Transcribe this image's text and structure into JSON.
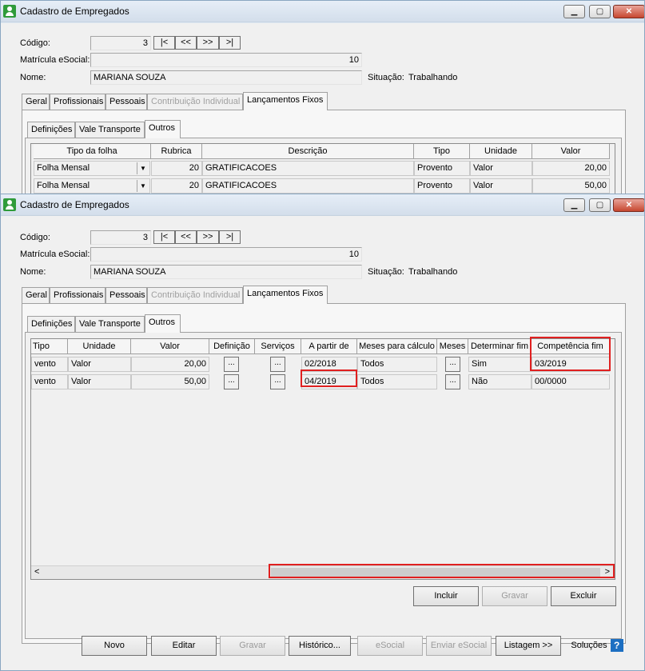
{
  "windows": [
    {
      "title": "Cadastro de Empregados",
      "controls": {
        "minimize": "▁",
        "maximize": "▢",
        "close": "✕"
      },
      "form": {
        "codigo_label": "Código:",
        "codigo_value": "3",
        "nav": [
          "|<",
          "<<",
          ">>",
          ">|"
        ],
        "matricula_label": "Matrícula eSocial:",
        "matricula_value": "10",
        "nome_label": "Nome:",
        "nome_value": "MARIANA SOUZA",
        "situacao_label": "Situação:",
        "situacao_value": "Trabalhando"
      },
      "tabs": [
        "Geral",
        "Profissionais",
        "Pessoais",
        "Contribuição Individual",
        "Lançamentos Fixos"
      ],
      "subtabs": [
        "Definições",
        "Vale Transporte",
        "Outros"
      ],
      "grid_headers": [
        "Tipo da folha",
        "Rubrica",
        "Descrição",
        "Tipo",
        "Unidade",
        "Valor"
      ],
      "rows": [
        {
          "tipo_folha": "Folha Mensal",
          "rubrica": "20",
          "descricao": "GRATIFICACOES",
          "tipo": "Provento",
          "unidade": "Valor",
          "valor": "20,00"
        },
        {
          "tipo_folha": "Folha Mensal",
          "rubrica": "20",
          "descricao": "GRATIFICACOES",
          "tipo": "Provento",
          "unidade": "Valor",
          "valor": "50,00"
        }
      ]
    },
    {
      "title": "Cadastro de Empregados",
      "controls": {
        "minimize": "▁",
        "maximize": "▢",
        "close": "✕"
      },
      "form": {
        "codigo_label": "Código:",
        "codigo_value": "3",
        "nav": [
          "|<",
          "<<",
          ">>",
          ">|"
        ],
        "matricula_label": "Matrícula eSocial:",
        "matricula_value": "10",
        "nome_label": "Nome:",
        "nome_value": "MARIANA SOUZA",
        "situacao_label": "Situação:",
        "situacao_value": "Trabalhando"
      },
      "tabs": [
        "Geral",
        "Profissionais",
        "Pessoais",
        "Contribuição Individual",
        "Lançamentos Fixos"
      ],
      "subtabs": [
        "Definições",
        "Vale Transporte",
        "Outros"
      ],
      "grid_headers": [
        "Tipo",
        "Unidade",
        "Valor",
        "Definição",
        "Serviços",
        "A partir de",
        "Meses para cálculo",
        "Meses",
        "Determinar fim",
        "Competência fim"
      ],
      "rows": [
        {
          "tipo": "vento",
          "unidade": "Valor",
          "valor": "20,00",
          "definicao": "...",
          "servicos": "...",
          "a_partir_de": "02/2018",
          "meses_calculo": "Todos",
          "meses": "...",
          "determinar_fim": "Sim",
          "competencia_fim": "03/2019"
        },
        {
          "tipo": "vento",
          "unidade": "Valor",
          "valor": "50,00",
          "definicao": "...",
          "servicos": "...",
          "a_partir_de": "04/2019",
          "meses_calculo": "Todos",
          "meses": "...",
          "determinar_fim": "Não",
          "competencia_fim": "00/0000"
        }
      ],
      "scrollbar": {
        "left": "<",
        "right": ">"
      },
      "grid_buttons": {
        "incluir": "Incluir",
        "gravar": "Gravar",
        "excluir": "Excluir"
      },
      "footer_buttons": {
        "novo": "Novo",
        "editar": "Editar",
        "gravar": "Gravar",
        "historico": "Histórico...",
        "esocial": "eSocial",
        "enviar_esocial": "Enviar eSocial",
        "listagem": "Listagem >>",
        "solucoes": "Soluções",
        "help": "?"
      }
    }
  ],
  "colors": {
    "highlight": "#e02020",
    "window_border": "#8aa6c1"
  }
}
